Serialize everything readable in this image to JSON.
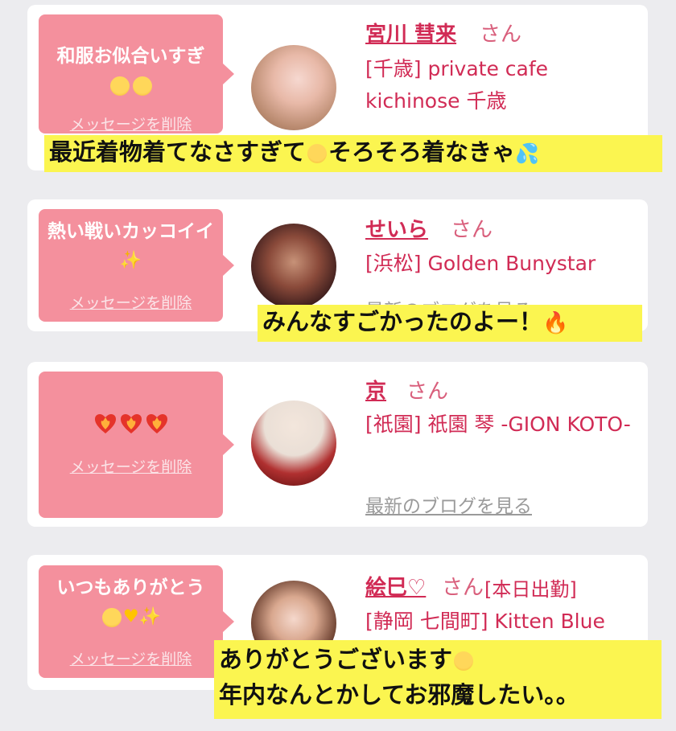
{
  "entries": [
    {
      "message": "和服お似合いすぎ",
      "delete_label": "メッセージを削除",
      "name": "宮川 彗来",
      "honorific": "さん",
      "shop": "[千歳] private cafe kichinose 千歳",
      "blog_label": ""
    },
    {
      "message": "熱い戦いカッコイイ",
      "delete_label": "メッセージを削除",
      "name": "せいら",
      "honorific": "さん",
      "shop": "[浜松] Golden Bunystar",
      "blog_label": "最新のブログを見る"
    },
    {
      "message": "",
      "delete_label": "メッセージを削除",
      "name": "京",
      "honorific": "さん",
      "shop": "[祇園] 祇園 琴 -GION KOTO-",
      "blog_label": "最新のブログを見る"
    },
    {
      "message": "いつもありがとう",
      "delete_label": "メッセージを削除",
      "name": "絵巳♡",
      "honorific": "さん",
      "status": "[本日出勤]",
      "shop": "[静岡 七間町] Kitten Blue",
      "blog_label": ""
    }
  ],
  "captions": [
    "最近着物着てなさすぎて",
    "そろそろ着なきゃ",
    "みんなすごかったのよー！",
    "ありがとうございます",
    "年内なんとかしてお邪魔したい。。"
  ],
  "icons": [
    "pleading-face-icon",
    "sparkles-icon",
    "heart-on-fire-icon",
    "yellow-heart-icon",
    "tears-of-joy-icon",
    "sweat-droplets-icon",
    "fire-icon",
    "smiling-face-icon"
  ],
  "colors": {
    "accent": "#d12b55",
    "bubble": "#f4909d",
    "caption_bg": "#fbf550"
  }
}
